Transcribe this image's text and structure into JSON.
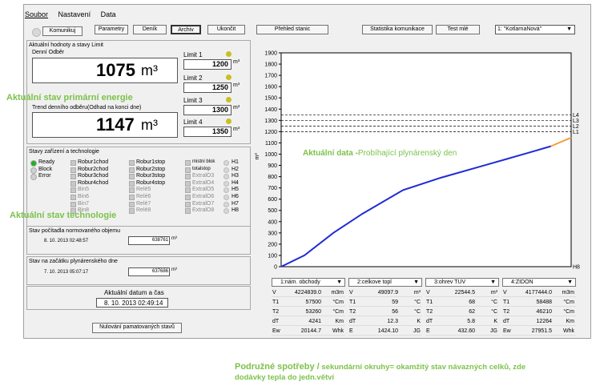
{
  "menu": [
    "Soubor",
    "Nastavení",
    "Data"
  ],
  "toolbar": {
    "connect": "Komunikuj",
    "params": "Parametry",
    "diary": "Deník",
    "archive": "Archiv",
    "quit": "Ukončit",
    "stations": "Přehled stanic",
    "comm_stats": "Statistika komunikace",
    "test": "Test mlé",
    "station_select": "1: \"KotlarnaNová\""
  },
  "values_panel": {
    "title": "Aktuální hodnoty a stavy Limit",
    "daily_label": "Denní Odběr",
    "daily_value": "1075",
    "unit": "m³",
    "trend_label": "Trend denního odběru(Odhad na konci dne)",
    "trend_value": "1147",
    "limits": [
      {
        "label": "Limit 1",
        "value": "1200"
      },
      {
        "label": "Limit 2",
        "value": "1250"
      },
      {
        "label": "Limit 3",
        "value": "1300"
      },
      {
        "label": "Limit 4",
        "value": "1350"
      }
    ],
    "limit_unit": "m³"
  },
  "states_panel": {
    "title": "Stavy zařízení a technologie",
    "col1": [
      "Ready",
      "Block",
      "Error"
    ],
    "col2": [
      "Robur1chod",
      "Robur2chod",
      "Robur3chod",
      "Robur4chod",
      "Bin5",
      "Bin6",
      "Bin7",
      "Bin8"
    ],
    "col3": [
      "Robur1stop",
      "Robur2stop",
      "Robur3stop",
      "Robur4stop",
      "Relé5",
      "Relé6",
      "Relé7",
      "Relé8"
    ],
    "col4": [
      "mistni blok",
      "totalstop",
      "ExtralO3",
      "ExtralO4",
      "ExtralO5",
      "ExtralO6",
      "ExtralO7",
      "ExtralO8"
    ],
    "col5": [
      "H1",
      "H2",
      "H3",
      "H4",
      "H5",
      "H6",
      "H7",
      "H8"
    ]
  },
  "counter": {
    "title": "Stav počítadla normovaného objemu",
    "date": "8. 10. 2013 02:48:57",
    "value": "638761",
    "unit": "m³"
  },
  "daystart": {
    "title": "Stav na začátku plynárenského dne",
    "date": "7. 10. 2013 05:07:17",
    "value": "637686",
    "unit": "m³"
  },
  "datetime": {
    "title": "Aktuální datum a čas",
    "value": "8. 10. 2013 02:49:14"
  },
  "reset_button": "Nulování pamatovaných stavů",
  "annotations": {
    "primary": "Aktuální stav primární energie",
    "tech": "Aktuální stav technologie",
    "chart_prefix": "Aktuální data -",
    "chart_suffix": "Probíhající plynárenský den",
    "footer_bold": "Podružné spotřeby /",
    "footer_rest": " sekundární okruhy= okamžitý stav návazných celků, zde",
    "footer_line2": "dodávky tepla do jedn.větví"
  },
  "chart_data": {
    "type": "line",
    "ylabel": "m³",
    "ylim": [
      0,
      1900
    ],
    "yticks": [
      0,
      100,
      200,
      300,
      400,
      500,
      600,
      700,
      800,
      900,
      1000,
      1100,
      1200,
      1300,
      1400,
      1500,
      1600,
      1700,
      1800,
      1900
    ],
    "limit_lines": [
      {
        "name": "L1",
        "value": 1200
      },
      {
        "name": "L2",
        "value": 1250
      },
      {
        "name": "L3",
        "value": 1300
      },
      {
        "name": "L4",
        "value": 1350
      },
      {
        "name": "H8",
        "value": 0
      }
    ],
    "series": [
      {
        "color": "#1f2bd6",
        "x": [
          0,
          0.08,
          0.18,
          0.28,
          0.42,
          0.55,
          0.7,
          0.85,
          0.93
        ],
        "y": [
          0,
          100,
          300,
          470,
          680,
          790,
          900,
          1010,
          1070
        ]
      },
      {
        "color": "#f0a040",
        "x": [
          0.93,
          1.0
        ],
        "y": [
          1070,
          1147
        ]
      }
    ]
  },
  "sub_panels": [
    {
      "title": "1:nám. obchody",
      "rows": [
        [
          "V",
          "4224839.0",
          "m3m"
        ],
        [
          "T1",
          "57500",
          "°Cm"
        ],
        [
          "T2",
          "53260",
          "°Cm"
        ],
        [
          "dT",
          "4241",
          "Km"
        ],
        [
          "Ew",
          "20144.7",
          "Whk"
        ]
      ]
    },
    {
      "title": "2:celkove topl",
      "rows": [
        [
          "V",
          "49097.9",
          "m³"
        ],
        [
          "T1",
          "59",
          "°C"
        ],
        [
          "T2",
          "56",
          "°C"
        ],
        [
          "dT",
          "12.3",
          "K"
        ],
        [
          "E",
          "1424.10",
          "JG"
        ]
      ]
    },
    {
      "title": "3:ohrev TUV",
      "rows": [
        [
          "V",
          "22544.5",
          "m³"
        ],
        [
          "T1",
          "68",
          "°C"
        ],
        [
          "T2",
          "62",
          "°C"
        ],
        [
          "dT",
          "5.8",
          "K"
        ],
        [
          "E",
          "432.60",
          "JG"
        ]
      ]
    },
    {
      "title": "4:ZIDON",
      "rows": [
        [
          "V",
          "4177444.0",
          "m3m"
        ],
        [
          "T1",
          "58488",
          "°Cm"
        ],
        [
          "T2",
          "46210",
          "°Cm"
        ],
        [
          "dT",
          "12264",
          "Km"
        ],
        [
          "Ew",
          "27951.5",
          "Whk"
        ]
      ]
    }
  ]
}
